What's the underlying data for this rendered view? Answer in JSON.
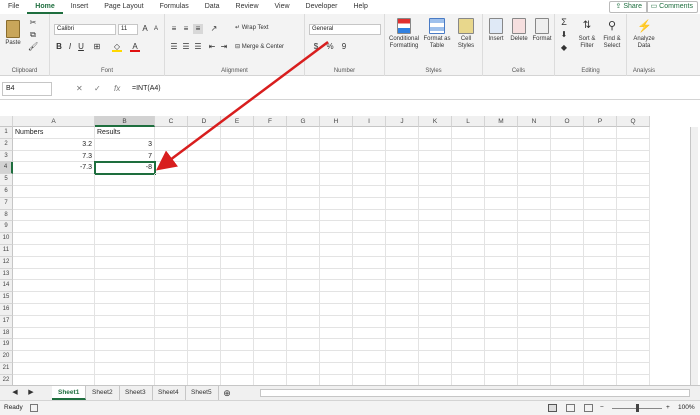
{
  "menu_tabs": [
    "File",
    "Home",
    "Insert",
    "Page Layout",
    "Formulas",
    "Data",
    "Review",
    "View",
    "Developer",
    "Help"
  ],
  "active_tab": "Home",
  "share_label": "Share",
  "comments_label": "Comments",
  "ribbon": {
    "clipboard": {
      "paste": "Paste",
      "label": "Clipboard"
    },
    "font": {
      "name": "Calibri",
      "size": "11",
      "label": "Font"
    },
    "alignment": {
      "wrap": "Wrap Text",
      "merge": "Merge & Center",
      "label": "Alignment"
    },
    "number": {
      "format": "General",
      "currency": "$",
      "percent": "%",
      "comma": "9",
      "label": "Number"
    },
    "styles": {
      "cond": "Conditional Formatting",
      "table": "Format as Table",
      "cell": "Cell Styles",
      "label": "Styles"
    },
    "cells": {
      "insert": "Insert",
      "delete": "Delete",
      "format": "Format",
      "label": "Cells"
    },
    "editing": {
      "sort": "Sort & Filter",
      "find": "Find & Select",
      "label": "Editing",
      "sum": "Σ"
    },
    "analysis": {
      "analyze": "Analyze Data",
      "label": "Analysis"
    }
  },
  "formula_bar": {
    "name_box": "B4",
    "fx": "fx",
    "cancel": "✕",
    "enter": "✓",
    "formula": "=INT(A4)"
  },
  "columns": [
    "A",
    "B",
    "C",
    "D",
    "E",
    "F",
    "G",
    "H",
    "I",
    "J",
    "K",
    "L",
    "M",
    "N",
    "O",
    "P",
    "Q"
  ],
  "rows": [
    "1",
    "2",
    "3",
    "4",
    "5",
    "6",
    "7",
    "8",
    "9",
    "10",
    "11",
    "12",
    "13",
    "14",
    "15",
    "16",
    "17",
    "18",
    "19",
    "20",
    "21",
    "22"
  ],
  "cells": {
    "A1": "Numbers",
    "B1": "Results",
    "A2": "3.2",
    "B2": "3",
    "A3": "7.3",
    "B3": "7",
    "A4": "-7.3",
    "B4": "-8"
  },
  "sheets": [
    "Sheet1",
    "Sheet2",
    "Sheet3",
    "Sheet4",
    "Sheet5"
  ],
  "active_sheet": "Sheet1",
  "status": {
    "ready": "Ready",
    "zoom": "100%"
  },
  "colors": {
    "accent": "#1e6e3e",
    "arrow": "#d81e1e",
    "fill_yellow": "#ffd800",
    "font_red": "#e01010"
  }
}
